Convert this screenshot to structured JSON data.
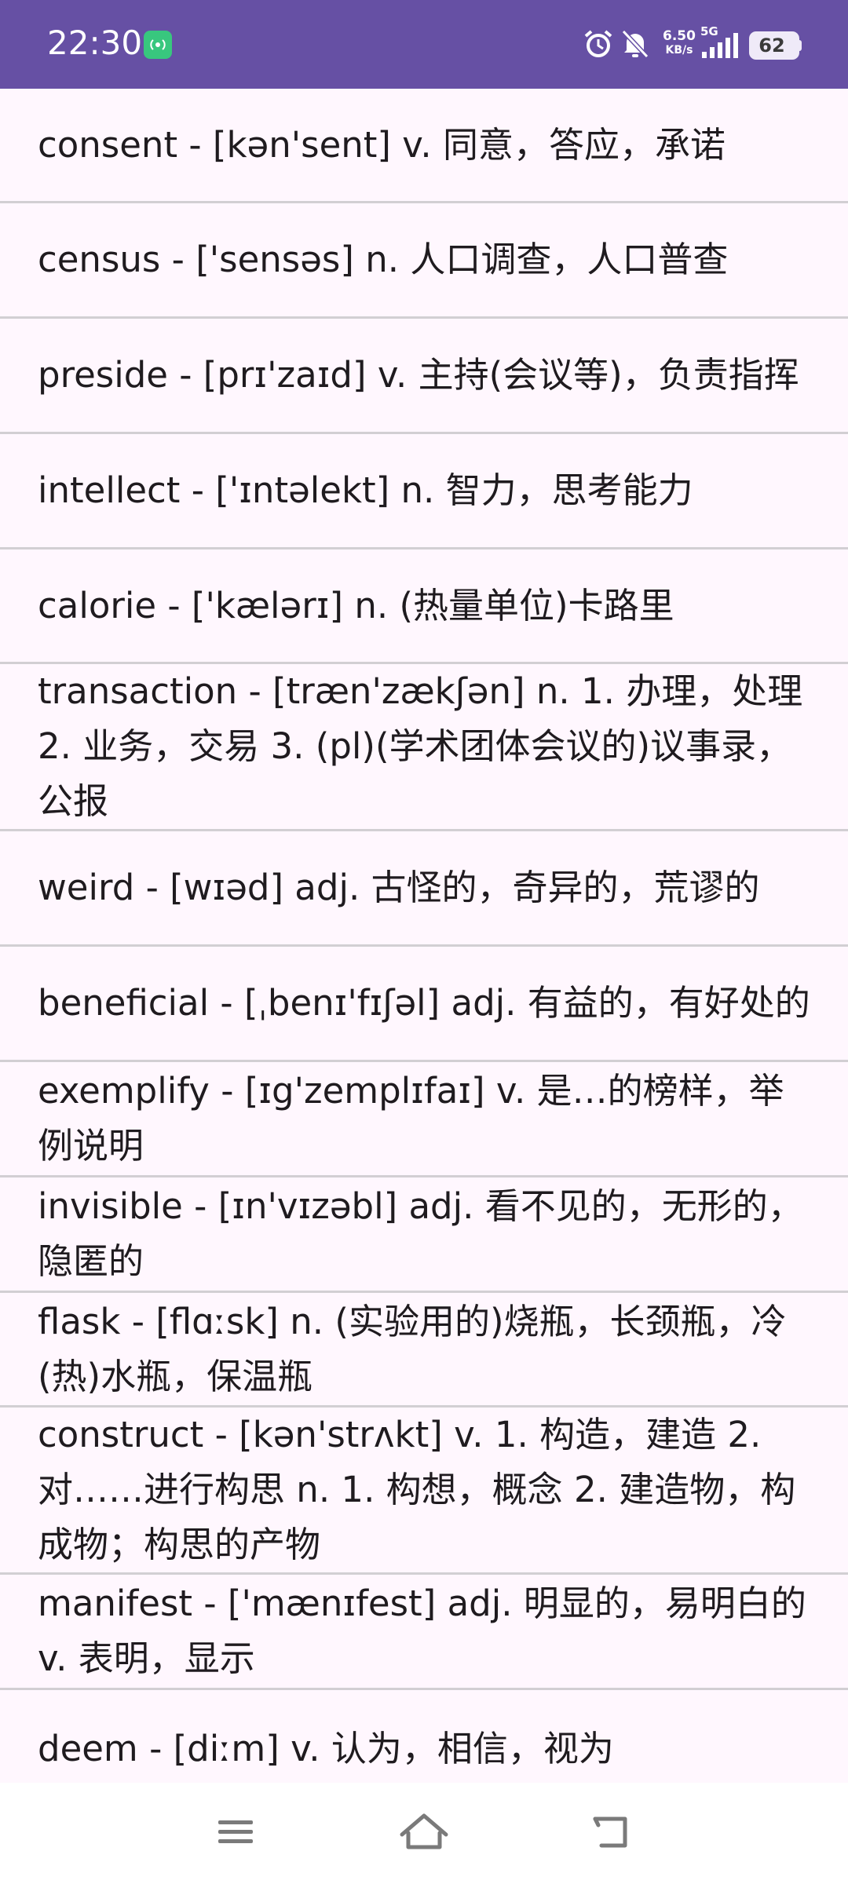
{
  "status_bar": {
    "time": "22:30",
    "net_speed_value": "6.50",
    "net_speed_unit": "KB/s",
    "network_type": "5G",
    "battery_level": "62",
    "icons": [
      "hotspot-icon",
      "alarm-icon",
      "mute-icon",
      "signal-icon",
      "battery-icon"
    ]
  },
  "words": [
    {
      "text": "consent - [kən'sent] v. 同意，答应，承诺"
    },
    {
      "text": "census - ['sensəs] n. 人口调查，人口普查"
    },
    {
      "text": "preside - [prɪ'zaɪd] v. 主持(会议等)，负责指挥"
    },
    {
      "text": "intellect - ['ɪntəlekt] n. 智力，思考能力"
    },
    {
      "text": "calorie - ['kælərɪ] n. (热量单位)卡路里"
    },
    {
      "text": "transaction - [træn'zækʃən] n. 1. 办理，处理 2. 业务，交易 3. (pl)(学术团体会议的)议事录，公报"
    },
    {
      "text": "weird - [wɪəd] adj. 古怪的，奇异的，荒谬的"
    },
    {
      "text": "beneficial - [ˌbenɪ'fɪʃəl] adj. 有益的，有好处的"
    },
    {
      "text": "exemplify - [ɪg'zemplɪfaɪ] v. 是…的榜样，举例说明"
    },
    {
      "text": "invisible - [ɪn'vɪzəbl] adj. 看不见的，无形的，隐匿的"
    },
    {
      "text": "flask - [flɑːsk] n. (实验用的)烧瓶，长颈瓶，冷(热)水瓶，保温瓶"
    },
    {
      "text": "construct - [kən'strʌkt] v. 1. 构造，建造 2. 对……进行构思 n. 1. 构想，概念 2. 建造物，构成物；构思的产物"
    },
    {
      "text": "manifest - ['mænɪfest] adj. 明显的，易明白的 v. 表明，显示"
    },
    {
      "text": "deem - [diːm] v. 认为，相信，视为"
    }
  ],
  "nav_bar": {
    "icons": [
      "menu-icon",
      "home-icon",
      "back-icon"
    ]
  }
}
